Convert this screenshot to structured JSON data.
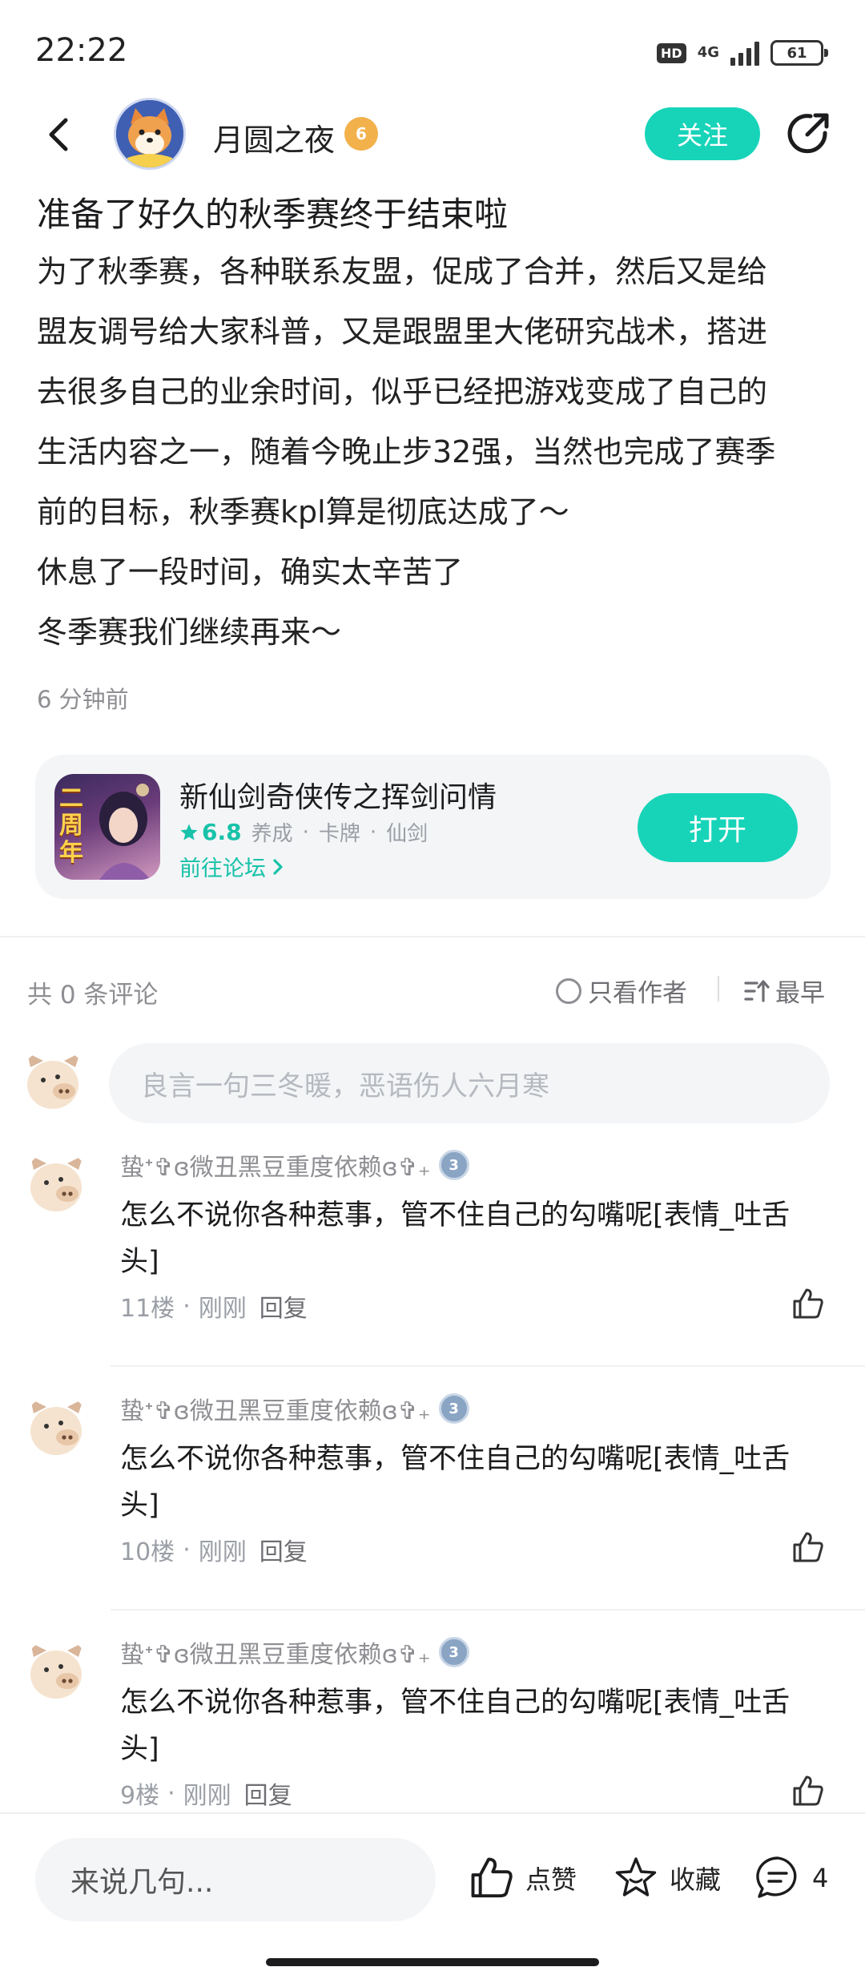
{
  "status_bar": {
    "time": "22:22",
    "hd": "HD",
    "network": "4G",
    "battery": "61"
  },
  "header": {
    "back_icon": "back-arrow-icon",
    "author_name": "月圆之夜",
    "author_level": "6",
    "follow_label": "关注",
    "share_icon": "share-icon"
  },
  "post": {
    "title": "准备了好久的秋季赛终于结束啦",
    "body_lines": [
      "为了秋季赛，各种联系友盟，促成了合并，然后又是给",
      "盟友调号给大家科普，又是跟盟里大佬研究战术，搭进",
      "去很多自己的业余时间，似乎已经把游戏变成了自己的",
      "生活内容之一，随着今晚止步32强，当然也完成了赛季",
      "前的目标，秋季赛kpl算是彻底达成了～",
      "休息了一段时间，确实太辛苦了",
      "冬季赛我们继续再来～"
    ],
    "time": "6 分钟前"
  },
  "game_card": {
    "icon_text": "二周年",
    "name": "新仙剑奇侠传之挥剑问情",
    "rating": "6.8",
    "tags": [
      "养成",
      "卡牌",
      "仙剑"
    ],
    "tag_separator": "·",
    "forum_link": "前往论坛",
    "open_label": "打开"
  },
  "comments_header": {
    "count_text": "共 0 条评论",
    "author_only": "只看作者",
    "sort": "最早"
  },
  "comment_input": {
    "placeholder": "良言一句三冬暖，恶语伤人六月寒"
  },
  "comments": [
    {
      "user": "蛰ᐩ✞ɞ微丑黑豆重度依赖ɞ✞₊",
      "level": "3",
      "text": "怎么不说你各种惹事，管不住自己的勾嘴呢[表情_吐舌头]",
      "floor": "11楼",
      "time": "刚刚",
      "reply": "回复"
    },
    {
      "user": "蛰ᐩ✞ɞ微丑黑豆重度依赖ɞ✞₊",
      "level": "3",
      "text": "怎么不说你各种惹事，管不住自己的勾嘴呢[表情_吐舌头]",
      "floor": "10楼",
      "time": "刚刚",
      "reply": "回复"
    },
    {
      "user": "蛰ᐩ✞ɞ微丑黑豆重度依赖ɞ✞₊",
      "level": "3",
      "text": "怎么不说你各种惹事，管不住自己的勾嘴呢[表情_吐舌头]",
      "floor": "9楼",
      "time": "刚刚",
      "reply": "回复"
    }
  ],
  "meta_separator": "·",
  "bottom_bar": {
    "input_placeholder": "来说几句...",
    "like_label": "点赞",
    "favorite_label": "收藏",
    "comment_count": "4"
  },
  "colors": {
    "accent": "#17d4b9",
    "accent_text": "#17c2a8",
    "muted": "#8e8e93"
  }
}
